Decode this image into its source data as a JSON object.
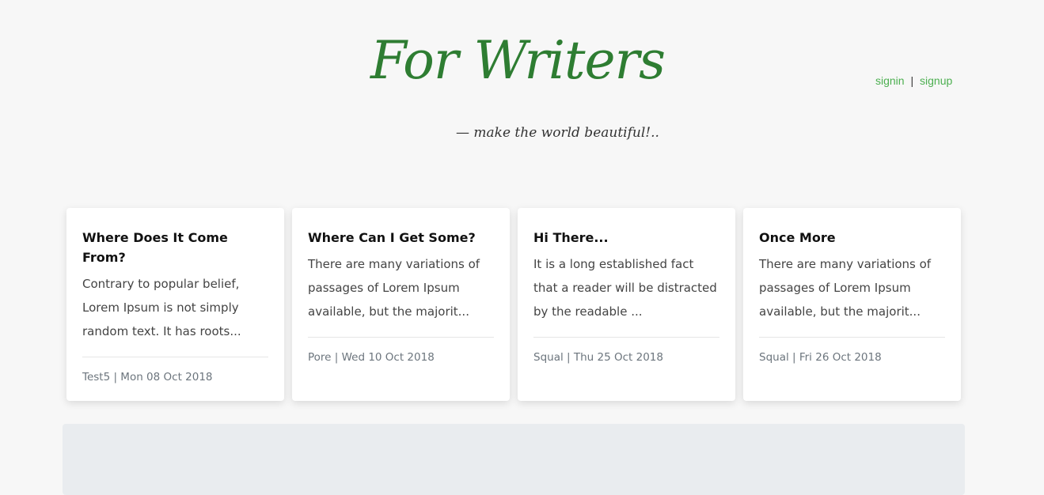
{
  "header": {
    "title": "For Writers",
    "tagline": "— make the world beautiful!..",
    "signin_label": "signin",
    "separator": "|",
    "signup_label": "signup"
  },
  "colors": {
    "brand": "#2e7d32",
    "link": "#4caf50",
    "background": "#f7f7f7",
    "panel": "#e9ecef"
  },
  "posts": [
    {
      "title": "Where Does It Come From?",
      "excerpt": "Contrary to popular belief, Lorem Ipsum is not simply random text. It has roots...",
      "meta": "Test5 | Mon 08 Oct 2018"
    },
    {
      "title": "Where Can I Get Some?",
      "excerpt": "There are many variations of passages of Lorem Ipsum available, but the majorit...",
      "meta": "Pore | Wed 10 Oct 2018"
    },
    {
      "title": "Hi There...",
      "excerpt": "It is a long established fact that a reader will be distracted by the readable ...",
      "meta": "Squal | Thu 25 Oct 2018"
    },
    {
      "title": "Once More",
      "excerpt": "There are many variations of passages of Lorem Ipsum available, but the majorit...",
      "meta": "Squal | Fri 26 Oct 2018"
    }
  ]
}
